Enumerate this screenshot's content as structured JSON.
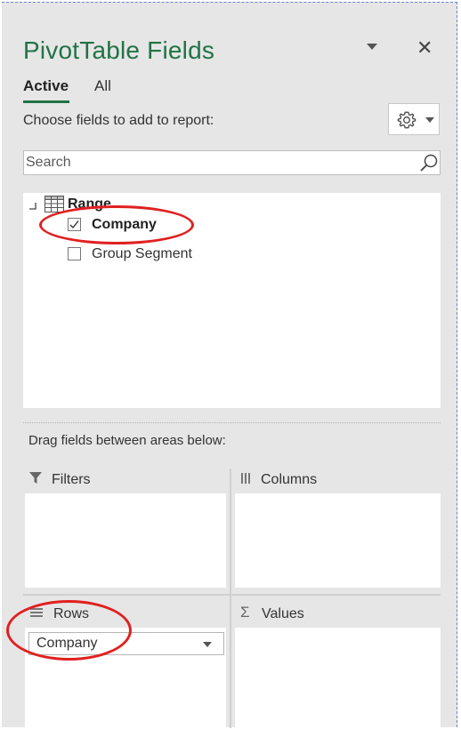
{
  "pane": {
    "title": "PivotTable Fields",
    "tabs": [
      {
        "label": "Active",
        "active": true
      },
      {
        "label": "All",
        "active": false
      }
    ],
    "choose_label": "Choose fields to add to report:",
    "tools_icon": "gear-icon"
  },
  "search": {
    "placeholder": "Search",
    "value": ""
  },
  "field_list": {
    "table_name": "Range",
    "fields": [
      {
        "label": "Company",
        "checked": true
      },
      {
        "label": "Group Segment",
        "checked": false
      }
    ]
  },
  "areas": {
    "instruction": "Drag fields between areas below:",
    "filters": {
      "label": "Filters",
      "icon": "filter-icon"
    },
    "columns": {
      "label": "Columns",
      "icon": "columns-icon"
    },
    "rows": {
      "label": "Rows",
      "icon": "rows-icon",
      "items": [
        "Company"
      ]
    },
    "values": {
      "label": "Values",
      "icon": "sigma-icon"
    }
  },
  "colors": {
    "accent": "#217346",
    "annotation": "#e02020",
    "panel_bg": "#e6e6e6"
  }
}
